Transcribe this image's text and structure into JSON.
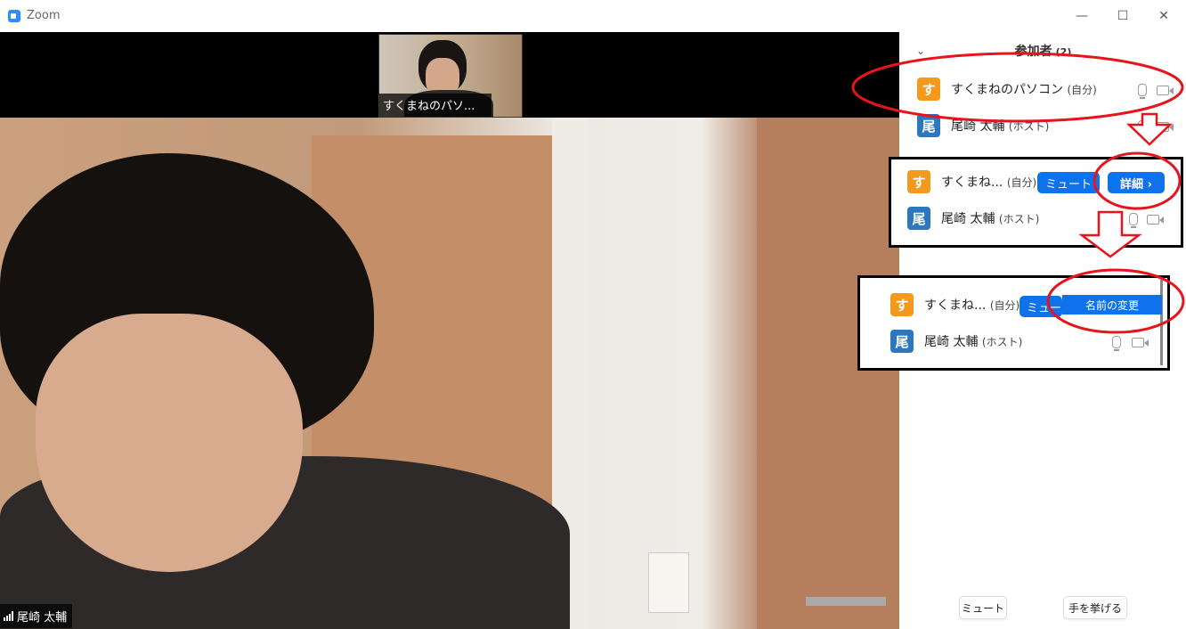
{
  "window": {
    "title": "Zoom"
  },
  "video": {
    "thumbnail_name": "すくまねのパソ...",
    "main_name": "尾崎 太輔"
  },
  "sidebar": {
    "title": "参加者",
    "count": "(2)",
    "participants": [
      {
        "avatar": "す",
        "name": "すくまねのパソコン",
        "suffix": "(自分)"
      },
      {
        "avatar": "尾",
        "name": "尾崎 太輔",
        "suffix": "(ホスト)"
      }
    ],
    "bottom": {
      "mute_label": "ミュート",
      "raise_hand_label": "手を挙げる"
    }
  },
  "inset1": {
    "participants": [
      {
        "avatar": "す",
        "name": "すくまね...",
        "suffix": "(自分)"
      },
      {
        "avatar": "尾",
        "name": "尾崎 太輔",
        "suffix": "(ホスト)"
      }
    ],
    "mute_label": "ミュート",
    "more_label": "詳細 ›"
  },
  "inset2": {
    "participants": [
      {
        "avatar": "す",
        "name": "すくまね...",
        "suffix": "(自分)"
      },
      {
        "avatar": "尾",
        "name": "尾崎 太輔",
        "suffix": "(ホスト)"
      }
    ],
    "mute_label": "ミュート",
    "rename_label": "名前の変更"
  },
  "colors": {
    "accent": "#0e72ed",
    "annotation": "#e8141b",
    "avatar_self": "#f39a1e",
    "avatar_host": "#2c78be"
  },
  "icons": [
    "zoom-app-icon",
    "minimize-icon",
    "maximize-icon",
    "close-icon",
    "collapse-chevron-icon",
    "mic-icon",
    "camera-icon",
    "signal-icon",
    "arrow-down-icon"
  ]
}
